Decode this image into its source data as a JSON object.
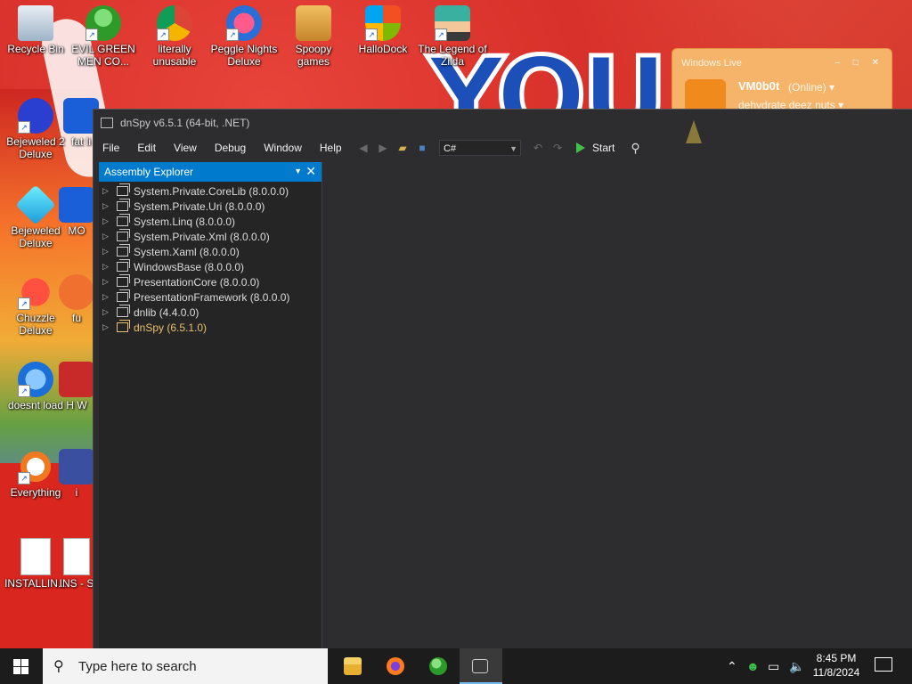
{
  "desktop": {
    "icons": [
      {
        "label": "Recycle Bin",
        "icon": "recycle-bin-icon"
      },
      {
        "label": "EVIL GREEN MEN CO...",
        "icon": "green-men-icon"
      },
      {
        "label": "literally unusable",
        "icon": "chrome-icon"
      },
      {
        "label": "Peggle Nights Deluxe",
        "icon": "peggle-icon"
      },
      {
        "label": "Spoopy games",
        "icon": "folder-icon"
      },
      {
        "label": "HalloDock",
        "icon": "windows-shield-icon"
      },
      {
        "label": "The Legend of Zilda",
        "icon": "zelda-icon"
      },
      {
        "label": "Bejeweled 2 Deluxe",
        "icon": "bejeweled2-icon"
      },
      {
        "label": "fat li",
        "icon": "app-icon"
      },
      {
        "label": "Bejeweled Deluxe",
        "icon": "bejeweled-icon"
      },
      {
        "label": "MO",
        "icon": "app-icon"
      },
      {
        "label": "Chuzzle Deluxe",
        "icon": "chuzzle-icon"
      },
      {
        "label": "fu",
        "icon": "app-icon"
      },
      {
        "label": "doesnt load",
        "icon": "thunderbird-icon"
      },
      {
        "label": "H W",
        "icon": "app-icon"
      },
      {
        "label": "Everything",
        "icon": "everything-search-icon"
      },
      {
        "label": "i",
        "icon": "app-icon"
      },
      {
        "label": "INSTALLIN...",
        "icon": "document-icon"
      },
      {
        "label": "INS - S",
        "icon": "document-icon"
      }
    ]
  },
  "wlm": {
    "title": "Windows Live",
    "name": "VM0b0t",
    "status": "(Online) ▾",
    "message": "dehydrate deez nuts ▾"
  },
  "dnspy": {
    "title": "dnSpy v6.5.1 (64-bit, .NET)",
    "menu": [
      "File",
      "Edit",
      "View",
      "Debug",
      "Window",
      "Help"
    ],
    "language": "C#",
    "start_label": "Start",
    "explorer_title": "Assembly Explorer",
    "assemblies": [
      {
        "label": "System.Private.CoreLib (8.0.0.0)",
        "highlight": false
      },
      {
        "label": "System.Private.Uri (8.0.0.0)",
        "highlight": false
      },
      {
        "label": "System.Linq (8.0.0.0)",
        "highlight": false
      },
      {
        "label": "System.Private.Xml (8.0.0.0)",
        "highlight": false
      },
      {
        "label": "System.Xaml (8.0.0.0)",
        "highlight": false
      },
      {
        "label": "WindowsBase (8.0.0.0)",
        "highlight": false
      },
      {
        "label": "PresentationCore (8.0.0.0)",
        "highlight": false
      },
      {
        "label": "PresentationFramework (8.0.0.0)",
        "highlight": false
      },
      {
        "label": "dnlib (4.4.0.0)",
        "highlight": false
      },
      {
        "label": "dnSpy (6.5.1.0)",
        "highlight": true
      }
    ]
  },
  "taskbar": {
    "search_placeholder": "Type here to search",
    "apps": [
      "file-explorer-icon",
      "firefox-icon",
      "windows-live-messenger-icon",
      "dnspy-icon"
    ],
    "time": "8:45 PM",
    "date": "11/8/2024"
  }
}
